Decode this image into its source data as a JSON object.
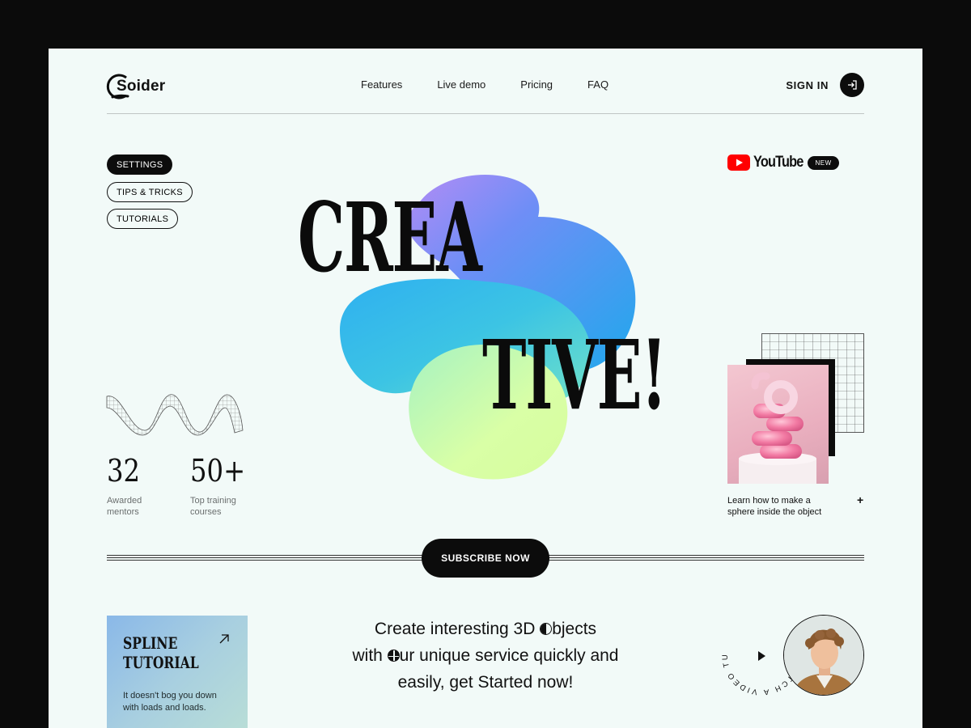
{
  "header": {
    "brand": "Soider",
    "nav": [
      "Features",
      "Live demo",
      "Pricing",
      "FAQ"
    ],
    "signin_label": "SIGN IN"
  },
  "categories": [
    {
      "label": "SETTINGS",
      "active": true
    },
    {
      "label": "TIPS & TRICKS",
      "active": false
    },
    {
      "label": "TUTORIALS",
      "active": false
    }
  ],
  "youtube": {
    "word": "YouTube",
    "badge": "NEW"
  },
  "hero": {
    "line1": "CREA",
    "line2": "TIVE!"
  },
  "stats": [
    {
      "value": "32",
      "label_line1": "Awarded",
      "label_line2": "mentors"
    },
    {
      "value": "50+",
      "label_line1": "Top training",
      "label_line2": "courses"
    }
  ],
  "feature_card": {
    "text_line1": "Learn how to make a",
    "text_line2": "sphere inside the object",
    "plus": "+"
  },
  "subscribe_label": "SUBSCRIBE NOW",
  "spline": {
    "title_line1": "SPLINE",
    "title_line2": "TUTORIAL",
    "desc_line1": "It doesn't bog you down",
    "desc_line2": "with loads and loads."
  },
  "tagline": {
    "l1_a": "Create interesting 3D ",
    "l1_b": "bjects",
    "l2_a": "with  ",
    "l2_b": "ur unique service quickly and",
    "l3": "easily, get Started now!"
  },
  "video": {
    "ring_text": "WATCH A VIDEO TUTORIAL"
  },
  "colors": {
    "accent": "#0c0c0c",
    "page_bg": "#f2faf8",
    "youtube_red": "#ff0000"
  }
}
